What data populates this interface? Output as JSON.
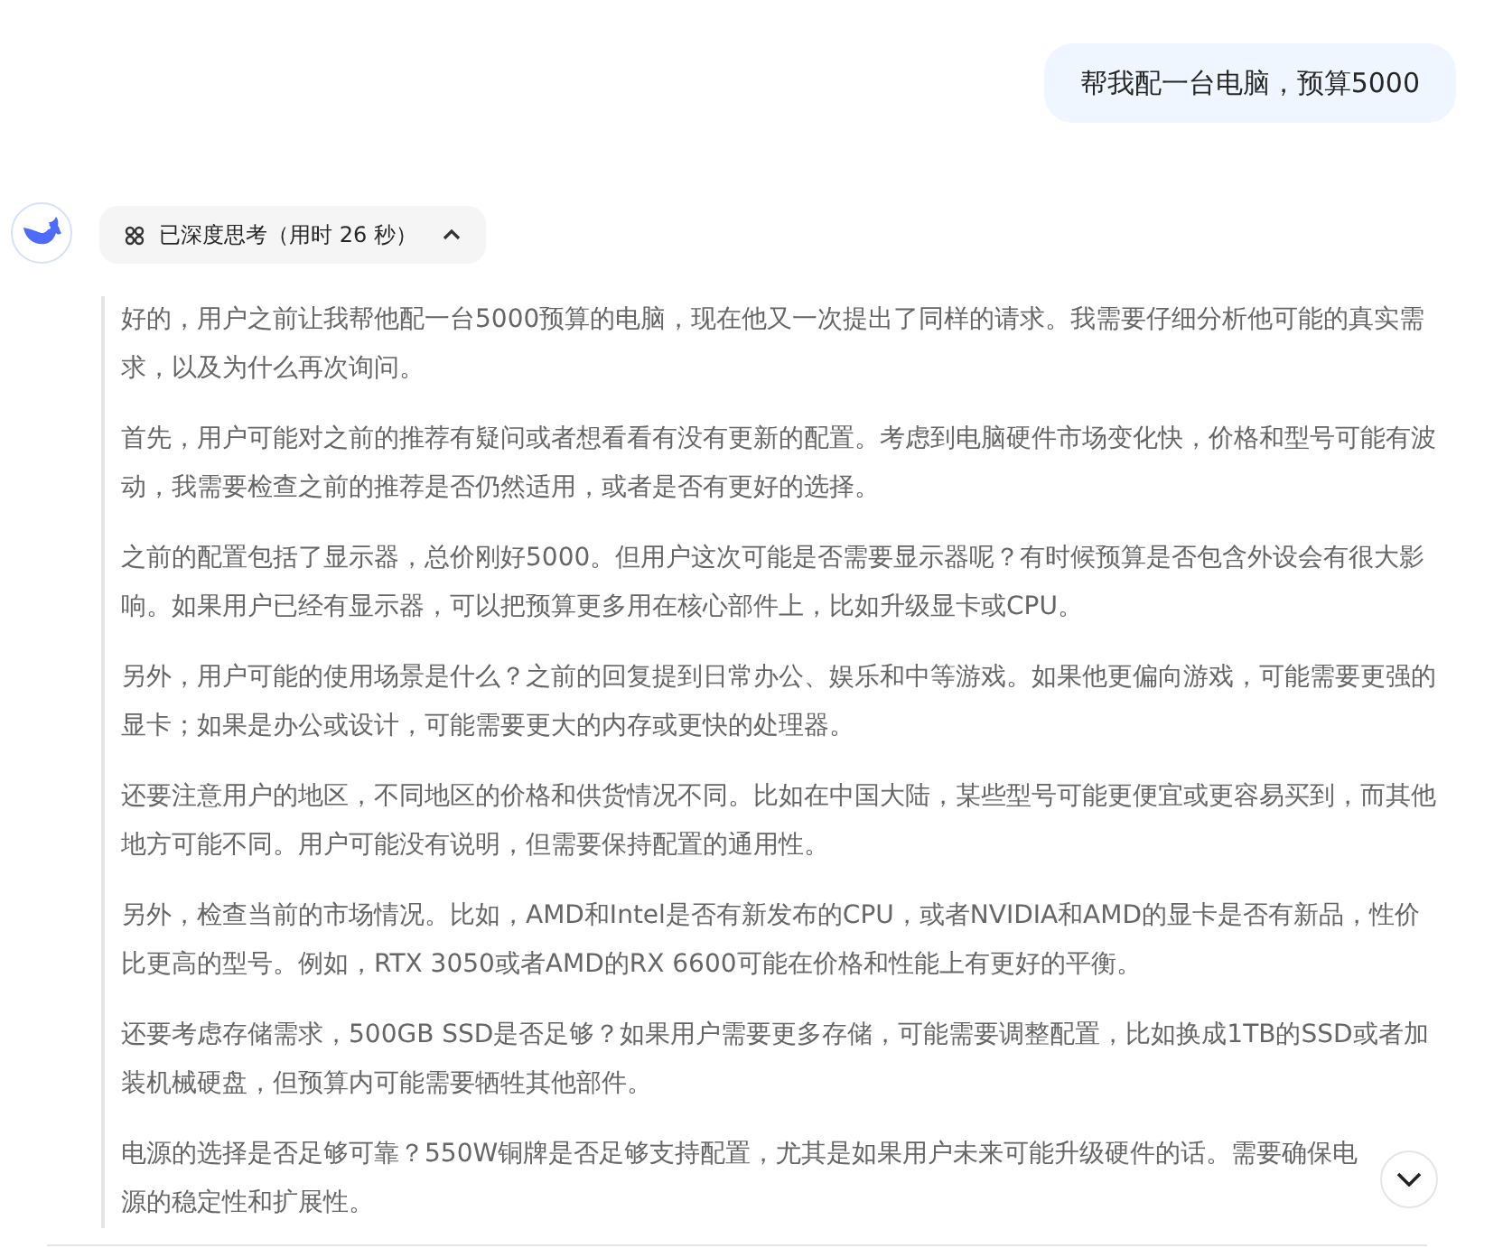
{
  "user_message": "帮我配一台电脑，预算5000",
  "thinking": {
    "label": "已深度思考（用时 26 秒）",
    "expanded": true,
    "paragraphs": [
      "好的，用户之前让我帮他配一台5000预算的电脑，现在他又一次提出了同样的请求。我需要仔细分析他可能的真实需求，以及为什么再次询问。",
      "首先，用户可能对之前的推荐有疑问或者想看看有没有更新的配置。考虑到电脑硬件市场变化快，价格和型号可能有波动，我需要检查之前的推荐是否仍然适用，或者是否有更好的选择。",
      "之前的配置包括了显示器，总价刚好5000。但用户这次可能是否需要显示器呢？有时候预算是否包含外设会有很大影响。如果用户已经有显示器，可以把预算更多用在核心部件上，比如升级显卡或CPU。",
      "另外，用户可能的使用场景是什么？之前的回复提到日常办公、娱乐和中等游戏。如果他更偏向游戏，可能需要更强的显卡；如果是办公或设计，可能需要更大的内存或更快的处理器。",
      "还要注意用户的地区，不同地区的价格和供货情况不同。比如在中国大陆，某些型号可能更便宜或更容易买到，而其他地方可能不同。用户可能没有说明，但需要保持配置的通用性。",
      "另外，检查当前的市场情况。比如，AMD和Intel是否有新发布的CPU，或者NVIDIA和AMD的显卡是否有新品，性价比更高的型号。例如，RTX 3050或者AMD的RX 6600可能在价格和性能上有更好的平衡。",
      "还要考虑存储需求，500GB SSD是否足够？如果用户需要更多存储，可能需要调整配置，比如换成1TB的SSD或者加装机械硬盘，但预算内可能需要牺牲其他部件。",
      "电源的选择是否足够可靠？550W铜牌是否足够支持配置，尤其是如果用户未来可能升级硬件的话。需要确保电源的稳定性和扩展性。"
    ]
  }
}
